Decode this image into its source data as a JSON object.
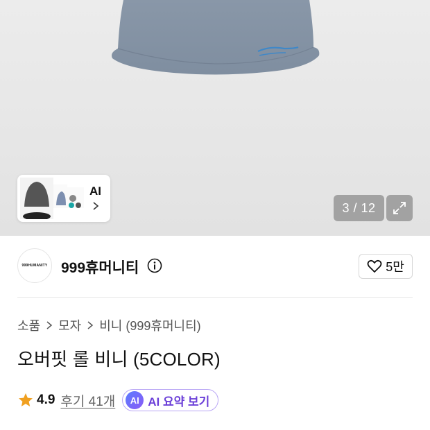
{
  "product_image": {
    "counter": "3 / 12",
    "ai_preview_label": "AI"
  },
  "store": {
    "logo_text": "999HUMANITY",
    "name": "999휴머니티",
    "like_count": "5만"
  },
  "breadcrumb": [
    "소품",
    "모자",
    "비니 (999휴머니티)"
  ],
  "product": {
    "title": "오버핏 롤 비니 (5COLOR)",
    "rating": "4.9",
    "reviews": "후기 41개",
    "ai_summary_badge": "AI",
    "ai_summary_label": "AI 요약 보기"
  },
  "colors": {
    "beanie": "#8c9aac",
    "star": "#f0a020",
    "ai_accent": "#6b3fd8"
  }
}
